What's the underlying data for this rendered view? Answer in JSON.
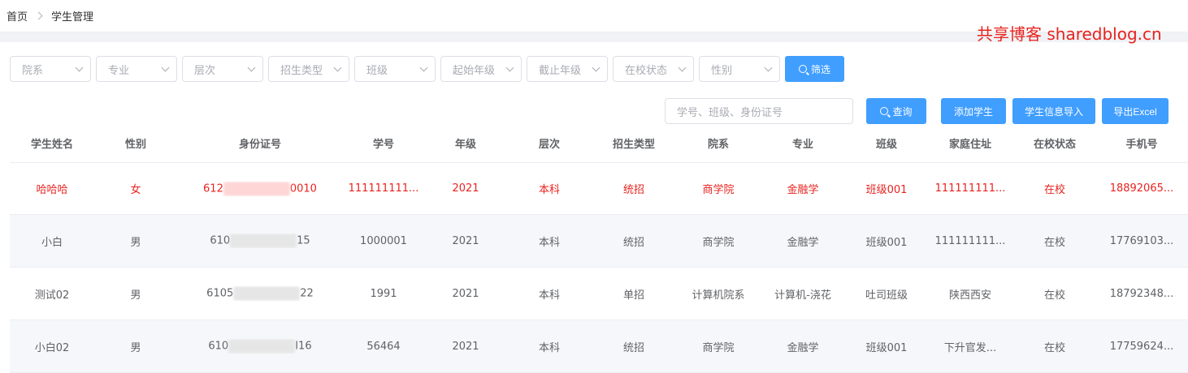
{
  "breadcrumb": {
    "home": "首页",
    "current": "学生管理"
  },
  "watermark": "共享博客 sharedblog.cn",
  "filters": [
    {
      "placeholder": "院系"
    },
    {
      "placeholder": "专业"
    },
    {
      "placeholder": "层次"
    },
    {
      "placeholder": "招生类型"
    },
    {
      "placeholder": "班级"
    },
    {
      "placeholder": "起始年级"
    },
    {
      "placeholder": "截止年级"
    },
    {
      "placeholder": "在校状态"
    },
    {
      "placeholder": "性别"
    }
  ],
  "filter_button": "筛选",
  "search": {
    "placeholder": "学号、班级、身份证号",
    "query_button": "查询"
  },
  "actions": {
    "add": "添加学生",
    "import": "学生信息导入",
    "export": "导出Excel"
  },
  "table": {
    "columns": [
      "学生姓名",
      "性别",
      "身份证号",
      "学号",
      "年级",
      "层次",
      "招生类型",
      "院系",
      "专业",
      "班级",
      "家庭住址",
      "在校状态",
      "手机号"
    ],
    "rows": [
      {
        "name": "哈哈哈",
        "gender": "女",
        "id_prefix": "612",
        "id_suffix": "0010",
        "student_no": "111111111...",
        "grade": "2021",
        "level": "本科",
        "enroll": "统招",
        "dept": "商学院",
        "major": "金融学",
        "class": "班级001",
        "address": "111111111...",
        "status": "在校",
        "phone": "18892065..."
      },
      {
        "name": "小白",
        "gender": "男",
        "id_prefix": "610",
        "id_suffix": "15",
        "student_no": "1000001",
        "grade": "2021",
        "level": "本科",
        "enroll": "统招",
        "dept": "商学院",
        "major": "金融学",
        "class": "班级001",
        "address": "111111111...",
        "status": "在校",
        "phone": "17769103..."
      },
      {
        "name": "测试02",
        "gender": "男",
        "id_prefix": "6105",
        "id_suffix": "22",
        "student_no": "1991",
        "grade": "2021",
        "level": "本科",
        "enroll": "单招",
        "dept": "计算机院系",
        "major": "计算机-浇花",
        "class": "吐司班级",
        "address": "陕西西安",
        "status": "在校",
        "phone": "18792348..."
      },
      {
        "name": "小白02",
        "gender": "男",
        "id_prefix": "610",
        "id_suffix": "I16",
        "student_no": "56464",
        "grade": "2021",
        "level": "本科",
        "enroll": "统招",
        "dept": "商学院",
        "major": "金融学",
        "class": "班级001",
        "address": "下升官发...",
        "status": "在校",
        "phone": "17759624..."
      }
    ]
  }
}
